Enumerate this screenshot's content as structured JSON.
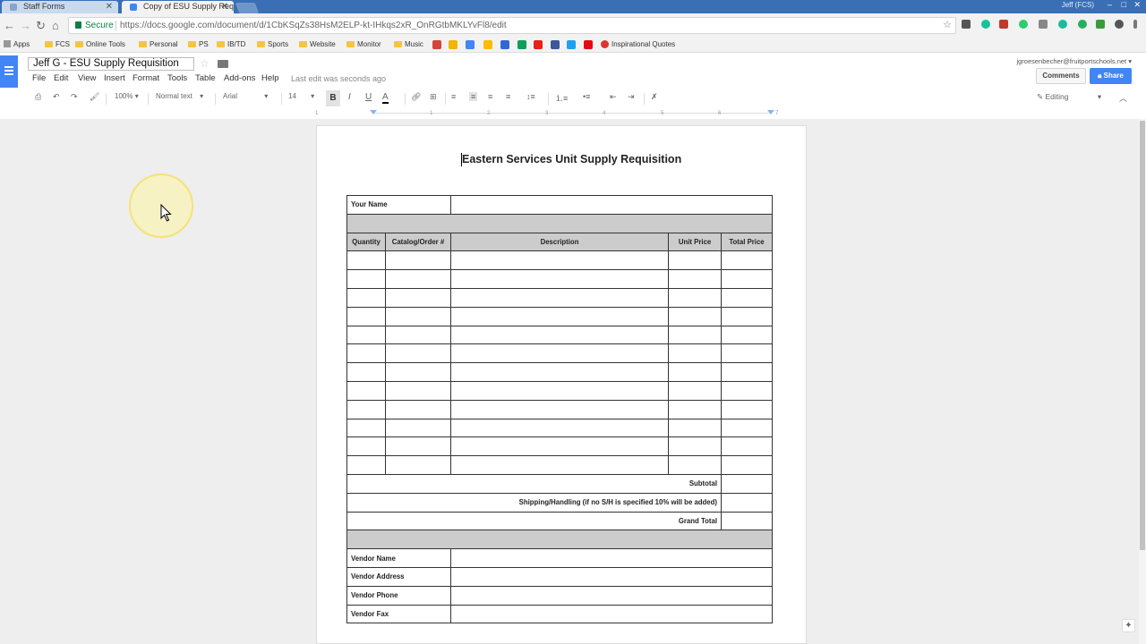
{
  "browser": {
    "tabs": [
      {
        "title": "Staff Forms",
        "active": false
      },
      {
        "title": "Copy of ESU Supply Req",
        "active": true
      }
    ],
    "window_user": "Jeff (FCS)",
    "secure_label": "Secure",
    "url": "https://docs.google.com/document/d/1CbKSqZs38HsM2ELP-kt-IHkqs2xR_OnRGtbMKLYvFl8/edit",
    "bookmarks": [
      "Apps",
      "FCS",
      "Online Tools",
      "Personal",
      "PS",
      "IB/TD",
      "Sports",
      "Website",
      "Monitor",
      "Music",
      "Inspirational Quotes"
    ]
  },
  "docs": {
    "doc_name": "Jeff G - ESU Supply Requisition",
    "menu": [
      "File",
      "Edit",
      "View",
      "Insert",
      "Format",
      "Tools",
      "Table",
      "Add-ons",
      "Help"
    ],
    "last_edit": "Last edit was seconds ago",
    "account": "jgroesenbecher@fruitportschools.net",
    "comments_label": "Comments",
    "share_label": "Share",
    "toolbar": {
      "zoom": "100%",
      "style": "Normal text",
      "font": "Arial",
      "size": "14",
      "mode": "Editing"
    },
    "ruler_numbers": [
      "1",
      "1",
      "2",
      "3",
      "4",
      "5",
      "6",
      "7"
    ]
  },
  "document": {
    "title": "Eastern Services Unit Supply Requisition",
    "your_name_label": "Your Name",
    "columns": [
      "Quantity",
      "Catalog/Order #",
      "Description",
      "Unit Price",
      "Total Price"
    ],
    "empty_item_rows": 12,
    "subtotal_label": "Subtotal",
    "shipping_label": "Shipping/Handling (if no S/H is specified 10% will be added)",
    "grand_total_label": "Grand Total",
    "vendor_fields": [
      "Vendor Name",
      "Vendor Address",
      "Vendor Phone",
      "Vendor Fax"
    ]
  }
}
